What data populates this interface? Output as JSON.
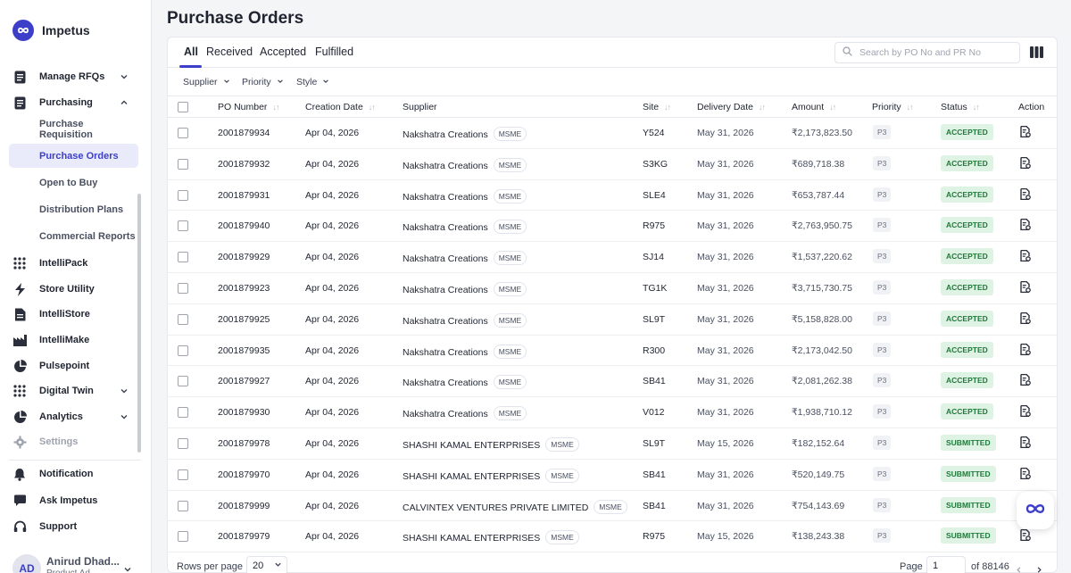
{
  "brand": {
    "name": "Impetus"
  },
  "sidebar": {
    "items": [
      {
        "label": "Manage RFQs",
        "icon": "doc-icon",
        "chevron": "down"
      },
      {
        "label": "Purchasing",
        "icon": "doc-icon",
        "chevron": "up"
      },
      {
        "label": "IntelliPack",
        "icon": "grid-icon"
      },
      {
        "label": "Store Utility",
        "icon": "bolt-icon"
      },
      {
        "label": "IntelliStore",
        "icon": "doc-icon"
      },
      {
        "label": "IntelliMake",
        "icon": "factory-icon"
      },
      {
        "label": "Pulsepoint",
        "icon": "pie-icon"
      },
      {
        "label": "Digital Twin",
        "icon": "grid-icon",
        "chevron": "down"
      },
      {
        "label": "Analytics",
        "icon": "pie-icon",
        "chevron": "down"
      },
      {
        "label": "Settings",
        "icon": "gear-icon"
      }
    ],
    "sub_items": [
      {
        "label": "Purchase Requisition"
      },
      {
        "label": "Purchase Orders",
        "active": true
      },
      {
        "label": "Open to Buy"
      },
      {
        "label": "Distribution Plans"
      },
      {
        "label": "Commercial Reports"
      }
    ],
    "bottom_items": [
      {
        "label": "Notification",
        "icon": "bell-icon"
      },
      {
        "label": "Ask Impetus",
        "icon": "chat-icon"
      },
      {
        "label": "Support",
        "icon": "headset-icon"
      }
    ],
    "user": {
      "initials": "AD",
      "name": "Anirud Dhad...",
      "role": "Product Ad..."
    }
  },
  "page": {
    "title": "Purchase Orders"
  },
  "tabs": [
    "All",
    "Received",
    "Accepted",
    "Fulfilled"
  ],
  "search": {
    "placeholder": "Search by PO No and PR No"
  },
  "filters": [
    "Supplier",
    "Priority",
    "Style"
  ],
  "table": {
    "columns": [
      "PO Number",
      "Creation Date",
      "Supplier",
      "Site",
      "Delivery Date",
      "Amount",
      "Priority",
      "Status",
      "Action"
    ],
    "rows": [
      {
        "po": "2001879934",
        "created": "Apr 04, 2026",
        "supplier": "Nakshatra Creations",
        "tag": "MSME",
        "site": "Y524",
        "delivery": "May 31, 2026",
        "amount": "₹2,173,823.50",
        "priority": "P3",
        "status": "ACCEPTED"
      },
      {
        "po": "2001879932",
        "created": "Apr 04, 2026",
        "supplier": "Nakshatra Creations",
        "tag": "MSME",
        "site": "S3KG",
        "delivery": "May 31, 2026",
        "amount": "₹689,718.38",
        "priority": "P3",
        "status": "ACCEPTED"
      },
      {
        "po": "2001879931",
        "created": "Apr 04, 2026",
        "supplier": "Nakshatra Creations",
        "tag": "MSME",
        "site": "SLE4",
        "delivery": "May 31, 2026",
        "amount": "₹653,787.44",
        "priority": "P3",
        "status": "ACCEPTED"
      },
      {
        "po": "2001879940",
        "created": "Apr 04, 2026",
        "supplier": "Nakshatra Creations",
        "tag": "MSME",
        "site": "R975",
        "delivery": "May 31, 2026",
        "amount": "₹2,763,950.75",
        "priority": "P3",
        "status": "ACCEPTED"
      },
      {
        "po": "2001879929",
        "created": "Apr 04, 2026",
        "supplier": "Nakshatra Creations",
        "tag": "MSME",
        "site": "SJ14",
        "delivery": "May 31, 2026",
        "amount": "₹1,537,220.62",
        "priority": "P3",
        "status": "ACCEPTED"
      },
      {
        "po": "2001879923",
        "created": "Apr 04, 2026",
        "supplier": "Nakshatra Creations",
        "tag": "MSME",
        "site": "TG1K",
        "delivery": "May 31, 2026",
        "amount": "₹3,715,730.75",
        "priority": "P3",
        "status": "ACCEPTED"
      },
      {
        "po": "2001879925",
        "created": "Apr 04, 2026",
        "supplier": "Nakshatra Creations",
        "tag": "MSME",
        "site": "SL9T",
        "delivery": "May 31, 2026",
        "amount": "₹5,158,828.00",
        "priority": "P3",
        "status": "ACCEPTED"
      },
      {
        "po": "2001879935",
        "created": "Apr 04, 2026",
        "supplier": "Nakshatra Creations",
        "tag": "MSME",
        "site": "R300",
        "delivery": "May 31, 2026",
        "amount": "₹2,173,042.50",
        "priority": "P3",
        "status": "ACCEPTED"
      },
      {
        "po": "2001879927",
        "created": "Apr 04, 2026",
        "supplier": "Nakshatra Creations",
        "tag": "MSME",
        "site": "SB41",
        "delivery": "May 31, 2026",
        "amount": "₹2,081,262.38",
        "priority": "P3",
        "status": "ACCEPTED"
      },
      {
        "po": "2001879930",
        "created": "Apr 04, 2026",
        "supplier": "Nakshatra Creations",
        "tag": "MSME",
        "site": "V012",
        "delivery": "May 31, 2026",
        "amount": "₹1,938,710.12",
        "priority": "P3",
        "status": "ACCEPTED"
      },
      {
        "po": "2001879978",
        "created": "Apr 04, 2026",
        "supplier": "SHASHI KAMAL ENTERPRISES",
        "tag": "MSME",
        "site": "SL9T",
        "delivery": "May 15, 2026",
        "amount": "₹182,152.64",
        "priority": "P3",
        "status": "SUBMITTED"
      },
      {
        "po": "2001879970",
        "created": "Apr 04, 2026",
        "supplier": "SHASHI KAMAL ENTERPRISES",
        "tag": "MSME",
        "site": "SB41",
        "delivery": "May 31, 2026",
        "amount": "₹520,149.75",
        "priority": "P3",
        "status": "SUBMITTED"
      },
      {
        "po": "2001879999",
        "created": "Apr 04, 2026",
        "supplier": "CALVINTEX VENTURES PRIVATE LIMITED",
        "tag": "MSME",
        "site": "SB41",
        "delivery": "May 31, 2026",
        "amount": "₹754,143.69",
        "priority": "P3",
        "status": "SUBMITTED"
      },
      {
        "po": "2001879979",
        "created": "Apr 04, 2026",
        "supplier": "SHASHI KAMAL ENTERPRISES",
        "tag": "MSME",
        "site": "R975",
        "delivery": "May 15, 2026",
        "amount": "₹138,243.38",
        "priority": "P3",
        "status": "SUBMITTED"
      }
    ]
  },
  "footer": {
    "rows_per_page_label": "Rows per page",
    "rows_per_page": "20",
    "page_label": "Page",
    "page": "1",
    "total": "of 88146"
  },
  "colors": {
    "accent": "#3d3fc9",
    "status_bg": "#dff3e4",
    "status_fg": "#1f7a3a"
  }
}
